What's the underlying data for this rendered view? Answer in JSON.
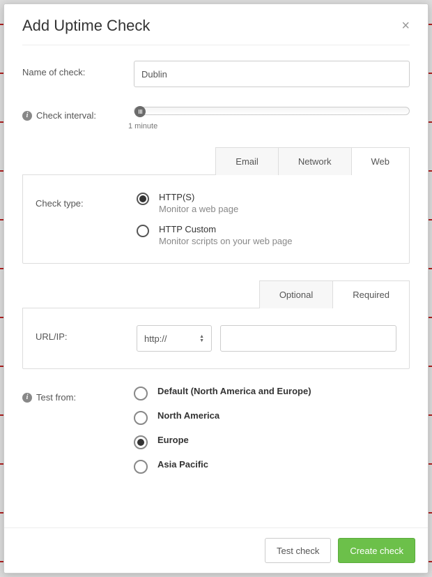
{
  "modal": {
    "title": "Add Uptime Check",
    "close_glyph": "×"
  },
  "fields": {
    "name_label": "Name of check:",
    "name_value": "Dublin",
    "interval_label": "Check interval:",
    "interval_value_label": "1 minute",
    "check_type_label": "Check type:",
    "url_ip_label": "URL/IP:",
    "url_scheme_value": "http://",
    "url_value": "",
    "test_from_label": "Test from:"
  },
  "tabs_top": {
    "items": [
      {
        "label": "Email",
        "active": false
      },
      {
        "label": "Network",
        "active": false
      },
      {
        "label": "Web",
        "active": true
      }
    ]
  },
  "check_type_options": [
    {
      "title": "HTTP(S)",
      "sub": "Monitor a web page",
      "checked": true
    },
    {
      "title": "HTTP Custom",
      "sub": "Monitor scripts on your web page",
      "checked": false
    }
  ],
  "tabs_mid": {
    "items": [
      {
        "label": "Optional",
        "active": false
      },
      {
        "label": "Required",
        "active": true
      }
    ]
  },
  "test_from_options": [
    {
      "label": "Default (North America and Europe)",
      "checked": false
    },
    {
      "label": "North America",
      "checked": false
    },
    {
      "label": "Europe",
      "checked": true
    },
    {
      "label": "Asia Pacific",
      "checked": false
    }
  ],
  "footer": {
    "test_label": "Test check",
    "create_label": "Create check"
  },
  "colors": {
    "primary": "#6cc04a"
  }
}
